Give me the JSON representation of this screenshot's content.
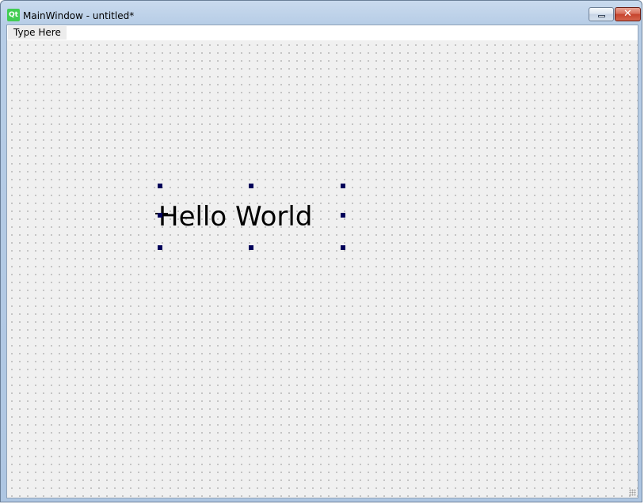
{
  "window": {
    "title": "MainWindow - untitled*",
    "app_icon": "qt-logo-icon",
    "app_icon_text": "Qt",
    "minimize_glyph": "▭",
    "close_glyph": "✕"
  },
  "menubar": {
    "placeholder_item": "Type Here"
  },
  "canvas": {
    "label_text": "Hello World"
  },
  "colors": {
    "qt_green": "#41cd52",
    "handle": "#00005a",
    "canvas_bg": "#f0f0f0"
  }
}
